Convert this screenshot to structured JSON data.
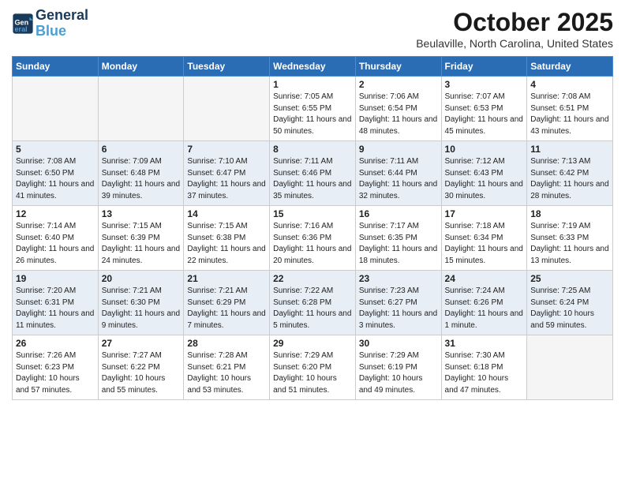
{
  "header": {
    "logo_line1": "General",
    "logo_line2": "Blue",
    "month": "October 2025",
    "location": "Beulaville, North Carolina, United States"
  },
  "weekdays": [
    "Sunday",
    "Monday",
    "Tuesday",
    "Wednesday",
    "Thursday",
    "Friday",
    "Saturday"
  ],
  "weeks": [
    [
      {
        "day": "",
        "sunrise": "",
        "sunset": "",
        "daylight": "",
        "empty": true
      },
      {
        "day": "",
        "sunrise": "",
        "sunset": "",
        "daylight": "",
        "empty": true
      },
      {
        "day": "",
        "sunrise": "",
        "sunset": "",
        "daylight": "",
        "empty": true
      },
      {
        "day": "1",
        "sunrise": "Sunrise: 7:05 AM",
        "sunset": "Sunset: 6:55 PM",
        "daylight": "Daylight: 11 hours and 50 minutes.",
        "empty": false
      },
      {
        "day": "2",
        "sunrise": "Sunrise: 7:06 AM",
        "sunset": "Sunset: 6:54 PM",
        "daylight": "Daylight: 11 hours and 48 minutes.",
        "empty": false
      },
      {
        "day": "3",
        "sunrise": "Sunrise: 7:07 AM",
        "sunset": "Sunset: 6:53 PM",
        "daylight": "Daylight: 11 hours and 45 minutes.",
        "empty": false
      },
      {
        "day": "4",
        "sunrise": "Sunrise: 7:08 AM",
        "sunset": "Sunset: 6:51 PM",
        "daylight": "Daylight: 11 hours and 43 minutes.",
        "empty": false
      }
    ],
    [
      {
        "day": "5",
        "sunrise": "Sunrise: 7:08 AM",
        "sunset": "Sunset: 6:50 PM",
        "daylight": "Daylight: 11 hours and 41 minutes.",
        "empty": false
      },
      {
        "day": "6",
        "sunrise": "Sunrise: 7:09 AM",
        "sunset": "Sunset: 6:48 PM",
        "daylight": "Daylight: 11 hours and 39 minutes.",
        "empty": false
      },
      {
        "day": "7",
        "sunrise": "Sunrise: 7:10 AM",
        "sunset": "Sunset: 6:47 PM",
        "daylight": "Daylight: 11 hours and 37 minutes.",
        "empty": false
      },
      {
        "day": "8",
        "sunrise": "Sunrise: 7:11 AM",
        "sunset": "Sunset: 6:46 PM",
        "daylight": "Daylight: 11 hours and 35 minutes.",
        "empty": false
      },
      {
        "day": "9",
        "sunrise": "Sunrise: 7:11 AM",
        "sunset": "Sunset: 6:44 PM",
        "daylight": "Daylight: 11 hours and 32 minutes.",
        "empty": false
      },
      {
        "day": "10",
        "sunrise": "Sunrise: 7:12 AM",
        "sunset": "Sunset: 6:43 PM",
        "daylight": "Daylight: 11 hours and 30 minutes.",
        "empty": false
      },
      {
        "day": "11",
        "sunrise": "Sunrise: 7:13 AM",
        "sunset": "Sunset: 6:42 PM",
        "daylight": "Daylight: 11 hours and 28 minutes.",
        "empty": false
      }
    ],
    [
      {
        "day": "12",
        "sunrise": "Sunrise: 7:14 AM",
        "sunset": "Sunset: 6:40 PM",
        "daylight": "Daylight: 11 hours and 26 minutes.",
        "empty": false
      },
      {
        "day": "13",
        "sunrise": "Sunrise: 7:15 AM",
        "sunset": "Sunset: 6:39 PM",
        "daylight": "Daylight: 11 hours and 24 minutes.",
        "empty": false
      },
      {
        "day": "14",
        "sunrise": "Sunrise: 7:15 AM",
        "sunset": "Sunset: 6:38 PM",
        "daylight": "Daylight: 11 hours and 22 minutes.",
        "empty": false
      },
      {
        "day": "15",
        "sunrise": "Sunrise: 7:16 AM",
        "sunset": "Sunset: 6:36 PM",
        "daylight": "Daylight: 11 hours and 20 minutes.",
        "empty": false
      },
      {
        "day": "16",
        "sunrise": "Sunrise: 7:17 AM",
        "sunset": "Sunset: 6:35 PM",
        "daylight": "Daylight: 11 hours and 18 minutes.",
        "empty": false
      },
      {
        "day": "17",
        "sunrise": "Sunrise: 7:18 AM",
        "sunset": "Sunset: 6:34 PM",
        "daylight": "Daylight: 11 hours and 15 minutes.",
        "empty": false
      },
      {
        "day": "18",
        "sunrise": "Sunrise: 7:19 AM",
        "sunset": "Sunset: 6:33 PM",
        "daylight": "Daylight: 11 hours and 13 minutes.",
        "empty": false
      }
    ],
    [
      {
        "day": "19",
        "sunrise": "Sunrise: 7:20 AM",
        "sunset": "Sunset: 6:31 PM",
        "daylight": "Daylight: 11 hours and 11 minutes.",
        "empty": false
      },
      {
        "day": "20",
        "sunrise": "Sunrise: 7:21 AM",
        "sunset": "Sunset: 6:30 PM",
        "daylight": "Daylight: 11 hours and 9 minutes.",
        "empty": false
      },
      {
        "day": "21",
        "sunrise": "Sunrise: 7:21 AM",
        "sunset": "Sunset: 6:29 PM",
        "daylight": "Daylight: 11 hours and 7 minutes.",
        "empty": false
      },
      {
        "day": "22",
        "sunrise": "Sunrise: 7:22 AM",
        "sunset": "Sunset: 6:28 PM",
        "daylight": "Daylight: 11 hours and 5 minutes.",
        "empty": false
      },
      {
        "day": "23",
        "sunrise": "Sunrise: 7:23 AM",
        "sunset": "Sunset: 6:27 PM",
        "daylight": "Daylight: 11 hours and 3 minutes.",
        "empty": false
      },
      {
        "day": "24",
        "sunrise": "Sunrise: 7:24 AM",
        "sunset": "Sunset: 6:26 PM",
        "daylight": "Daylight: 11 hours and 1 minute.",
        "empty": false
      },
      {
        "day": "25",
        "sunrise": "Sunrise: 7:25 AM",
        "sunset": "Sunset: 6:24 PM",
        "daylight": "Daylight: 10 hours and 59 minutes.",
        "empty": false
      }
    ],
    [
      {
        "day": "26",
        "sunrise": "Sunrise: 7:26 AM",
        "sunset": "Sunset: 6:23 PM",
        "daylight": "Daylight: 10 hours and 57 minutes.",
        "empty": false
      },
      {
        "day": "27",
        "sunrise": "Sunrise: 7:27 AM",
        "sunset": "Sunset: 6:22 PM",
        "daylight": "Daylight: 10 hours and 55 minutes.",
        "empty": false
      },
      {
        "day": "28",
        "sunrise": "Sunrise: 7:28 AM",
        "sunset": "Sunset: 6:21 PM",
        "daylight": "Daylight: 10 hours and 53 minutes.",
        "empty": false
      },
      {
        "day": "29",
        "sunrise": "Sunrise: 7:29 AM",
        "sunset": "Sunset: 6:20 PM",
        "daylight": "Daylight: 10 hours and 51 minutes.",
        "empty": false
      },
      {
        "day": "30",
        "sunrise": "Sunrise: 7:29 AM",
        "sunset": "Sunset: 6:19 PM",
        "daylight": "Daylight: 10 hours and 49 minutes.",
        "empty": false
      },
      {
        "day": "31",
        "sunrise": "Sunrise: 7:30 AM",
        "sunset": "Sunset: 6:18 PM",
        "daylight": "Daylight: 10 hours and 47 minutes.",
        "empty": false
      },
      {
        "day": "",
        "sunrise": "",
        "sunset": "",
        "daylight": "",
        "empty": true
      }
    ]
  ]
}
